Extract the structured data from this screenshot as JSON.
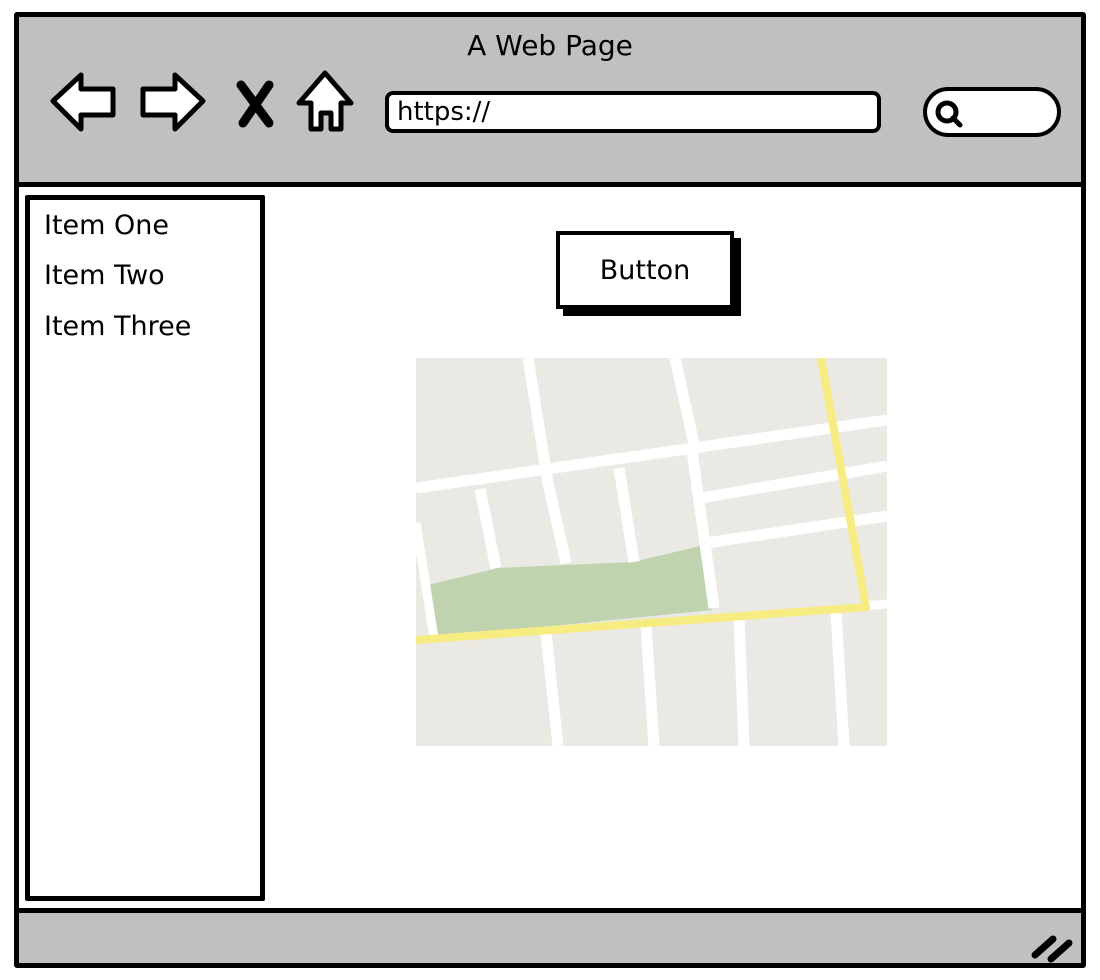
{
  "window": {
    "title": "A Web Page"
  },
  "toolbar": {
    "back_icon": "back-arrow-icon",
    "forward_icon": "forward-arrow-icon",
    "stop_icon": "stop-x-icon",
    "home_icon": "home-icon",
    "search_icon": "search-icon"
  },
  "address_bar": {
    "value": "https://"
  },
  "sidebar": {
    "items": [
      {
        "label": "Item One"
      },
      {
        "label": "Item Two"
      },
      {
        "label": "Item Three"
      }
    ]
  },
  "main": {
    "button_label": "Button",
    "map_image": "map-image",
    "colors": {
      "map_block": "#ebe9e3",
      "map_park": "#bfd4ae",
      "map_highway": "#f7ec82",
      "map_street": "#ffffff"
    }
  },
  "colors": {
    "chrome": "#c0c0c0",
    "outline": "#000000",
    "surface": "#ffffff"
  }
}
